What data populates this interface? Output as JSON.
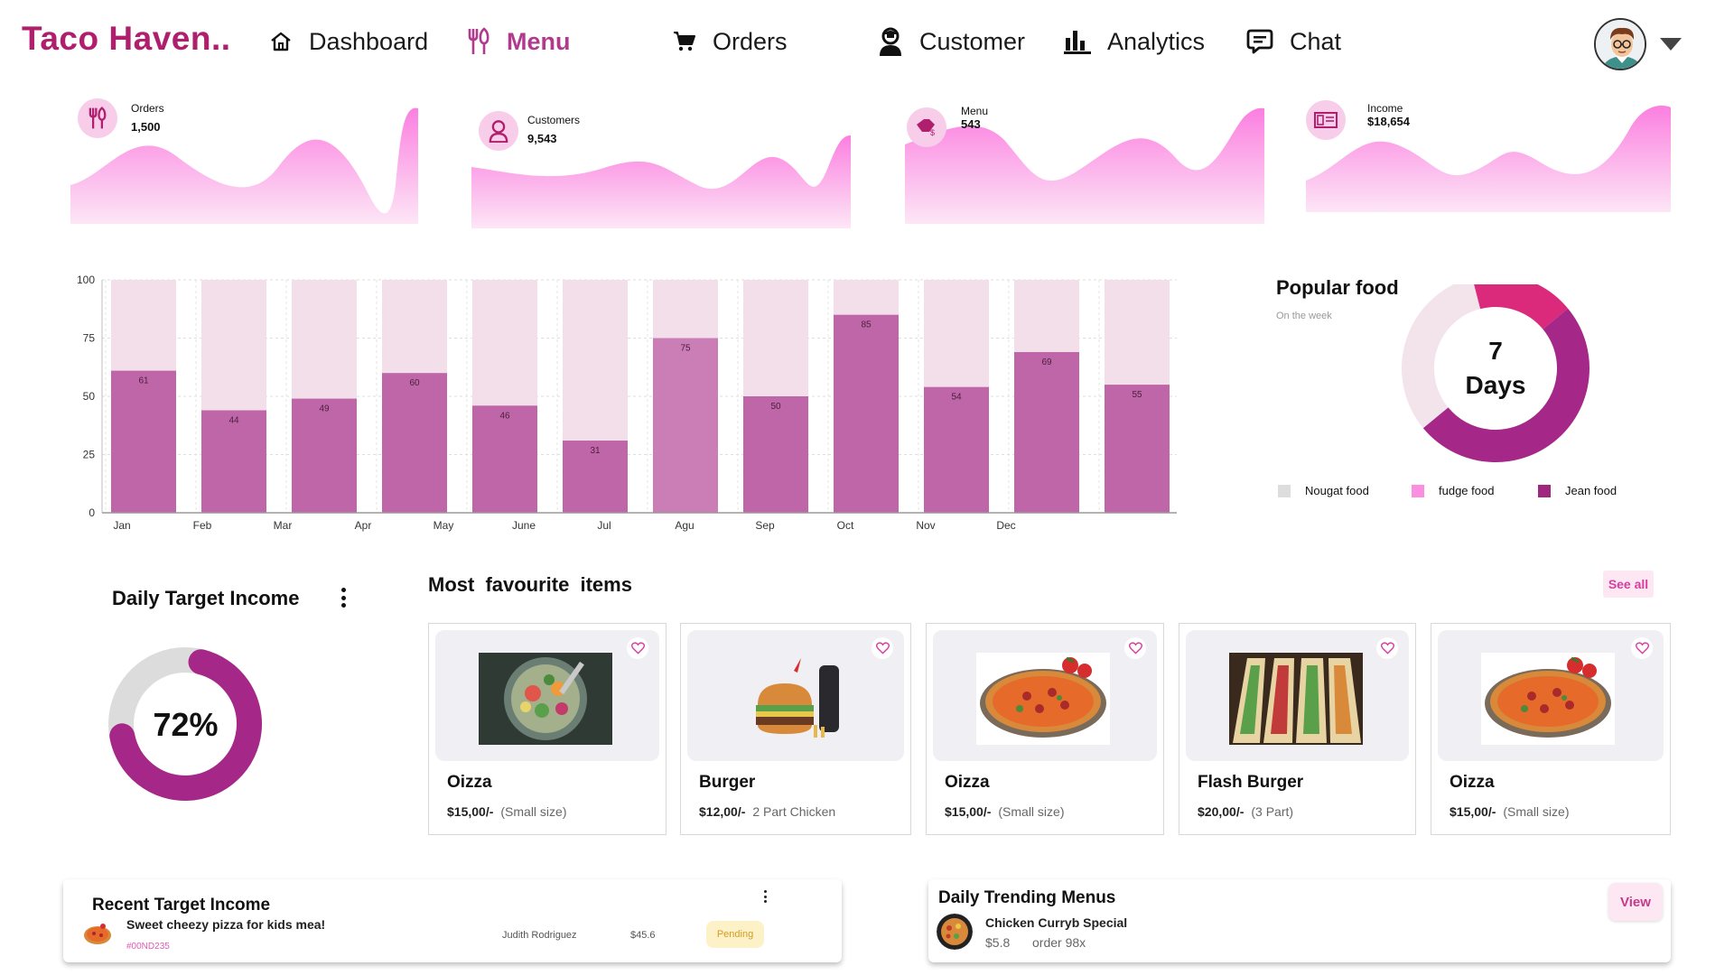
{
  "brand": "Taco Haven..",
  "nav": {
    "items": [
      {
        "label": "Dashboard",
        "icon": "home-icon"
      },
      {
        "label": "Menu",
        "icon": "utensils-icon",
        "active": true
      },
      {
        "label": "Orders",
        "icon": "cart-icon"
      },
      {
        "label": "Customer",
        "icon": "customer-icon"
      },
      {
        "label": "Analytics",
        "icon": "bar-chart-icon"
      },
      {
        "label": "Chat",
        "icon": "chat-icon"
      }
    ]
  },
  "stats": [
    {
      "label": "Orders",
      "value": "1,500",
      "icon": "utensils-icon"
    },
    {
      "label": "Customers",
      "value": "9,543",
      "icon": "customer-icon"
    },
    {
      "label": "Menu",
      "value": "543",
      "icon": "menu-tag-icon"
    },
    {
      "label": "Income",
      "value": "$18,654",
      "icon": "money-icon"
    }
  ],
  "chart_data": [
    {
      "type": "bar",
      "categories": [
        "Jan",
        "Feb",
        "Mar",
        "Apr",
        "May",
        "June",
        "Jul",
        "Agu",
        "Sep",
        "Oct",
        "Nov",
        "Dec",
        ""
      ],
      "values": [
        61,
        44,
        49,
        60,
        46,
        31,
        75,
        50,
        85,
        54,
        69,
        55
      ],
      "ylim": [
        0,
        100
      ],
      "yticks": [
        0,
        25,
        50,
        75,
        100
      ],
      "grid": true,
      "colors": {
        "bar": "#bf66a8",
        "bar_highlight": "#cb7db6",
        "background_bar": "#f2dfe9"
      }
    },
    {
      "type": "pie",
      "title": "Popular food",
      "subtitle": "On the week",
      "center_text": [
        "7",
        "Days"
      ],
      "series": [
        {
          "name": "Nougat food",
          "value": 32,
          "color": "#f3e4ec"
        },
        {
          "name": "fudge food",
          "value": 18,
          "color": "#db2a7c"
        },
        {
          "name": "Jean food",
          "value": 50,
          "color": "#a52788"
        }
      ],
      "legend": "bottom",
      "legend_colors": [
        "#dddddd",
        "#fb8ee0",
        "#a0277f"
      ]
    },
    {
      "type": "pie",
      "title": "Daily Target Income",
      "value_percent": 72,
      "center_text": "72%",
      "colors": {
        "filled": "#a52788",
        "remaining": "#dcdcdc"
      }
    }
  ],
  "favourites": {
    "title": "Most  favourite  items",
    "see_all": "See all",
    "items": [
      {
        "name": "Oizza",
        "price": "$15,00/-",
        "note": "(Small size)",
        "image": "salad"
      },
      {
        "name": "Burger",
        "price": "$12,00/-",
        "note": "2 Part Chicken",
        "image": "burger"
      },
      {
        "name": "Oizza",
        "price": "$15,00/-",
        "note": "(Small size)",
        "image": "pizza"
      },
      {
        "name": "Flash Burger",
        "price": "$20,00/-",
        "note": "(3 Part)",
        "image": "tacos"
      },
      {
        "name": "Oizza",
        "price": "$15,00/-",
        "note": "(Small size)",
        "image": "pizza"
      }
    ]
  },
  "recent": {
    "title": "Recent Target Income",
    "description": "Sweet cheezy pizza for kids mea!",
    "code": "#00ND235",
    "customer": "Judith Rodriguez",
    "amount": "$45.6",
    "status": "Pending"
  },
  "trending": {
    "title": "Daily Trending Menus",
    "name": "Chicken Curryb Special",
    "price": "$5.8",
    "orders": "order 98x",
    "view": "View"
  },
  "colors": {
    "brand": "#b01f6e",
    "accent": "#b23a8d",
    "pink_light": "#fde7f3"
  }
}
